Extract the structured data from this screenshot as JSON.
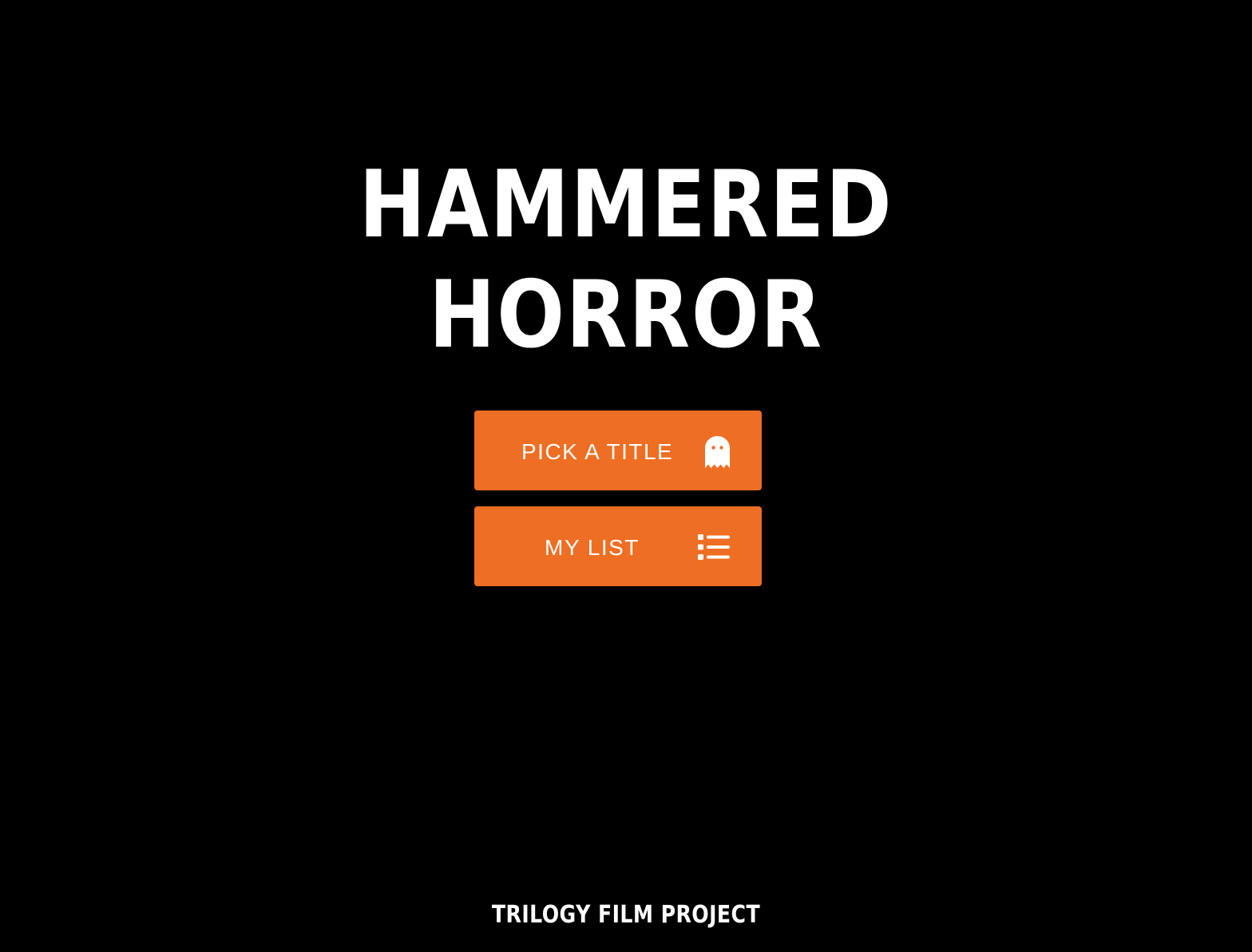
{
  "app": {
    "title_line1": "HAMMERED",
    "title_line2": "HORROR"
  },
  "menu": {
    "pick_title": {
      "label": "PICK A TITLE",
      "icon": "ghost-icon"
    },
    "my_list": {
      "label": "MY LIST",
      "icon": "list-icon"
    }
  },
  "footer": {
    "text": "TRILOGY FILM PROJECT"
  },
  "colors": {
    "background": "#000000",
    "button": "#ee6e23",
    "text": "#ffffff"
  }
}
